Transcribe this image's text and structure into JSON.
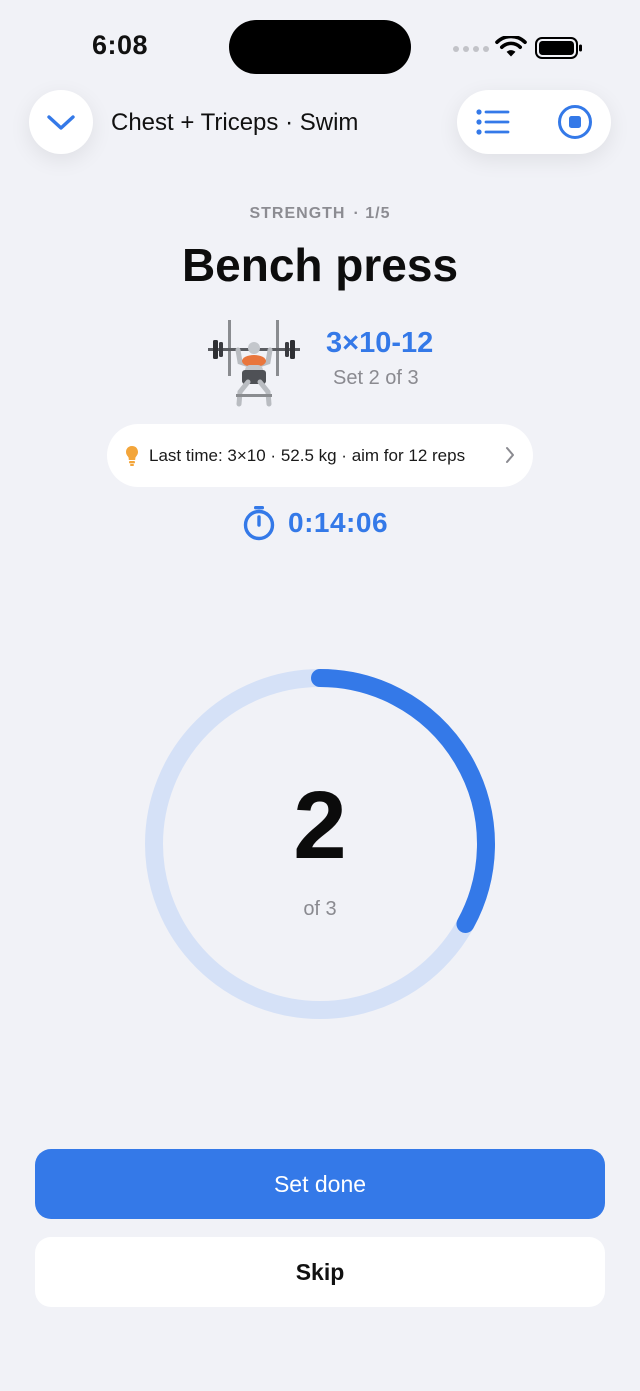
{
  "status_bar": {
    "time": "6:08"
  },
  "header": {
    "workout_title": "Chest + Triceps · Swim",
    "collapse_icon": "chevron-down-icon",
    "list_icon": "list-icon",
    "stop_icon": "stop-icon"
  },
  "exercise": {
    "category": "STRENGTH",
    "position": "· 1/5",
    "name": "Bench press",
    "scheme": "3×10-12",
    "set_progress": "Set 2 of 3",
    "illustration_icon": "bench-press-illustration"
  },
  "hint": {
    "icon": "lightbulb-icon",
    "text": "Last time: 3×10 · 52.5 kg · aim for 12 reps"
  },
  "timer": {
    "icon": "stopwatch-icon",
    "value": "0:14:06"
  },
  "ring": {
    "current": "2",
    "subtitle": "of 3",
    "progress_fraction": 0.33
  },
  "actions": {
    "primary_label": "Set done",
    "secondary_label": "Skip"
  },
  "colors": {
    "accent": "#3479e8",
    "ring_track": "#d5e1f7",
    "background": "#f1f2f7",
    "hint_bulb": "#f3a53a"
  }
}
